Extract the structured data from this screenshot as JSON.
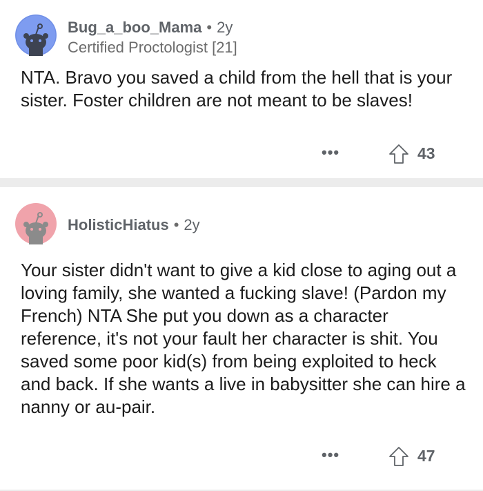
{
  "comments": [
    {
      "username": "Bug_a_boo_Mama",
      "separator": "•",
      "age": "2y",
      "flair": "Certified Proctologist [21]",
      "body": "NTA. Bravo you saved a child from the hell that is your sister. Foster children are not meant to be slaves!",
      "more": "•••",
      "score": "43",
      "avatar_color": "#7e9cf0",
      "avatar_icon": "snoo-avatar-icon"
    },
    {
      "username": "HolisticHiatus",
      "separator": "•",
      "age": "2y",
      "flair": "",
      "body": "Your sister didn't want to give a kid close to aging out a loving family, she wanted a fucking slave! (Pardon my French) NTA She put you down as a character reference, it's not your fault her character is shit. You saved some poor kid(s) from being exploited to heck and back. If she wants a live in babysitter she can hire a nanny or au-pair.",
      "more": "•••",
      "score": "47",
      "avatar_color": "#f0a3ab",
      "avatar_icon": "snoo-avatar-icon"
    }
  ],
  "colors": {
    "divider": "#ececec",
    "meta_text": "#5f6368",
    "body_text": "#1c1c1c"
  }
}
